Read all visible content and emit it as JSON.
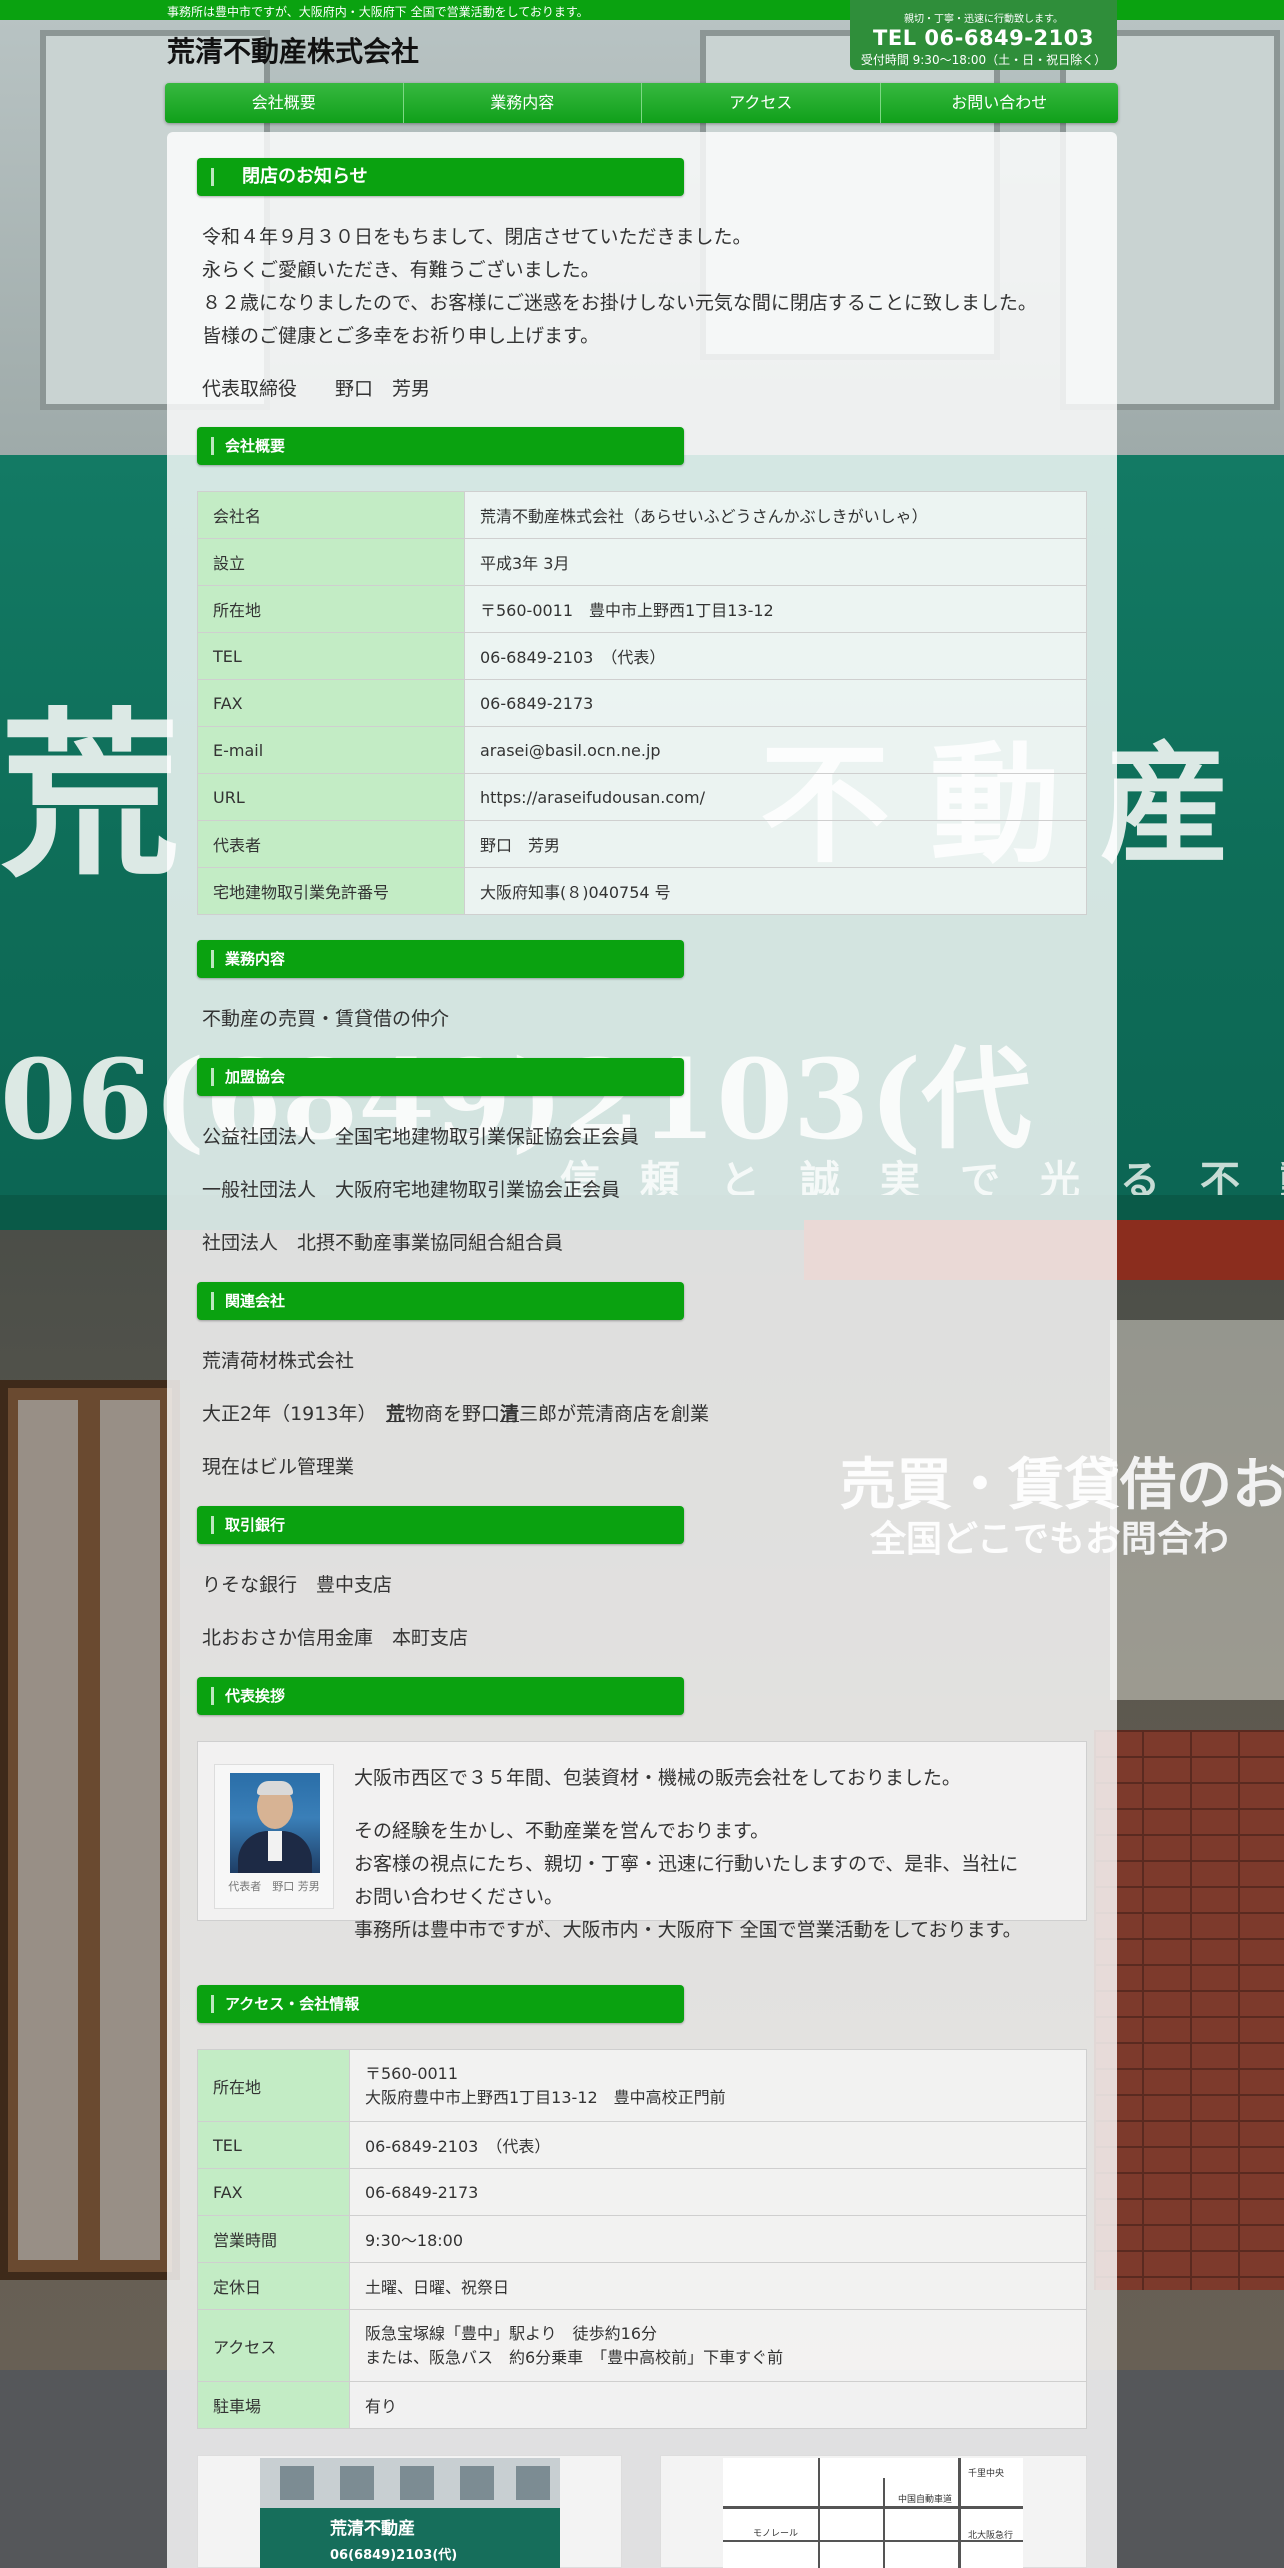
{
  "header": {
    "tagline": "事務所は豊中市ですが、大阪府内・大阪府下 全国で営業活動をしております。",
    "logo": "荒清不動産株式会社",
    "tel_note": "親切・丁寧・迅速に行動致します。",
    "tel": "TEL 06-6849-2103",
    "hours": "受付時間 9:30〜18:00（土・日・祝日除く）"
  },
  "nav": [
    "会社概要",
    "業務内容",
    "アクセス",
    "お問い合わせ"
  ],
  "background": {
    "sign_big_1": "荒",
    "sign_big_2": "不動産",
    "sign_phone": "06(6849)2103(代",
    "sign_sub": "信頼と誠実で光る不動産",
    "shop_sign_1": "売買・賃貸借のお",
    "shop_sign_2": "全国どこでもお問合わ"
  },
  "closing": {
    "heading": "閉店のお知らせ",
    "lines": [
      "令和４年９月３０日をもちまして、閉店させていただきました。",
      "永らくご愛顧いただき、有難うございました。",
      "８２歳になりましたので、お客様にご迷惑をお掛けしない元気な間に閉店することに致しました。",
      "皆様のご健康とご多幸をお祈り申し上げます。"
    ],
    "signature": "代表取締役　　野口　芳男"
  },
  "company": {
    "heading": "会社概要",
    "rows": [
      {
        "k": "会社名",
        "v": "荒清不動産株式会社（あらせいふどうさんかぶしきがいしゃ）"
      },
      {
        "k": "設立",
        "v": "平成3年 3月"
      },
      {
        "k": "所在地",
        "v": "〒560-0011　豊中市上野西1丁目13-12"
      },
      {
        "k": "TEL",
        "v": "06-6849-2103　（代表）"
      },
      {
        "k": "FAX",
        "v": "06-6849-2173"
      },
      {
        "k": "E-mail",
        "v": "arasei@basil.ocn.ne.jp"
      },
      {
        "k": "URL",
        "v": "https://araseifudousan.com/"
      },
      {
        "k": "代表者",
        "v": "野口　芳男"
      },
      {
        "k": "宅地建物取引業免許番号",
        "v": "大阪府知事(８)040754 号"
      }
    ]
  },
  "business": {
    "heading": "業務内容",
    "text": "不動産の売買・賃貸借の仲介"
  },
  "associations": {
    "heading": "加盟協会",
    "items": [
      "公益社団法人　全国宅地建物取引業保証協会正会員",
      "一般社団法人　大阪府宅地建物取引業協会正会員",
      "社団法人　北摂不動産事業協同組合組合員"
    ]
  },
  "related": {
    "heading": "関連会社",
    "company": "荒清荷材株式会社",
    "history_prefix": "大正2年（1913年）　",
    "history_ch1": "荒",
    "history_mid": "物商を野口",
    "history_ch2": "清",
    "history_suffix": "三郎が荒清商店を創業",
    "current": "現在はビル管理業"
  },
  "banks": {
    "heading": "取引銀行",
    "items": [
      "りそな銀行　豊中支店",
      "北おおさか信用金庫　本町支店"
    ]
  },
  "greeting": {
    "heading": "代表挨拶",
    "caption": "代表者　野口 芳男",
    "lines": [
      "大阪市西区で３５年間、包装資材・機械の販売会社をしておりました。",
      "その経験を生かし、不動産業を営んでおります。",
      "お客様の視点にたち、親切・丁寧・迅速に行動いたしますので、是非、当社に",
      "お問い合わせください。",
      "事務所は豊中市ですが、大阪市内・大阪府下 全国で営業活動をしております。"
    ]
  },
  "access": {
    "heading": "アクセス・会社情報",
    "address_zip": "〒560-0011",
    "address_line": "大阪府豊中市上野西1丁目13-12　豊中高校正門前",
    "rows": [
      {
        "k": "所在地"
      },
      {
        "k": "TEL",
        "v": "06-6849-2103　（代表）"
      },
      {
        "k": "FAX",
        "v": "06-6849-2173"
      },
      {
        "k": "営業時間",
        "v": "9:30〜18:00"
      },
      {
        "k": "定休日",
        "v": "土曜、日曜、祝祭日"
      },
      {
        "k": "アクセス"
      },
      {
        "k": "駐車場",
        "v": "有り"
      }
    ],
    "access_line1": "阪急宝塚線「豊中」駅より　徒歩約16分",
    "access_line2": "または、阪急バス　約6分乗車　「豊中高校前」下車すぐ前"
  },
  "thumbs": {
    "photo_sign": "荒清不動産",
    "photo_tel": "06(6849)2103(代)",
    "map_labels": [
      "中国自動車道",
      "モノレール",
      "北大阪急行",
      "千里中央"
    ]
  },
  "colors": {
    "brand_green": "#0aa210",
    "table_key_bg": "#c3ecc5"
  }
}
